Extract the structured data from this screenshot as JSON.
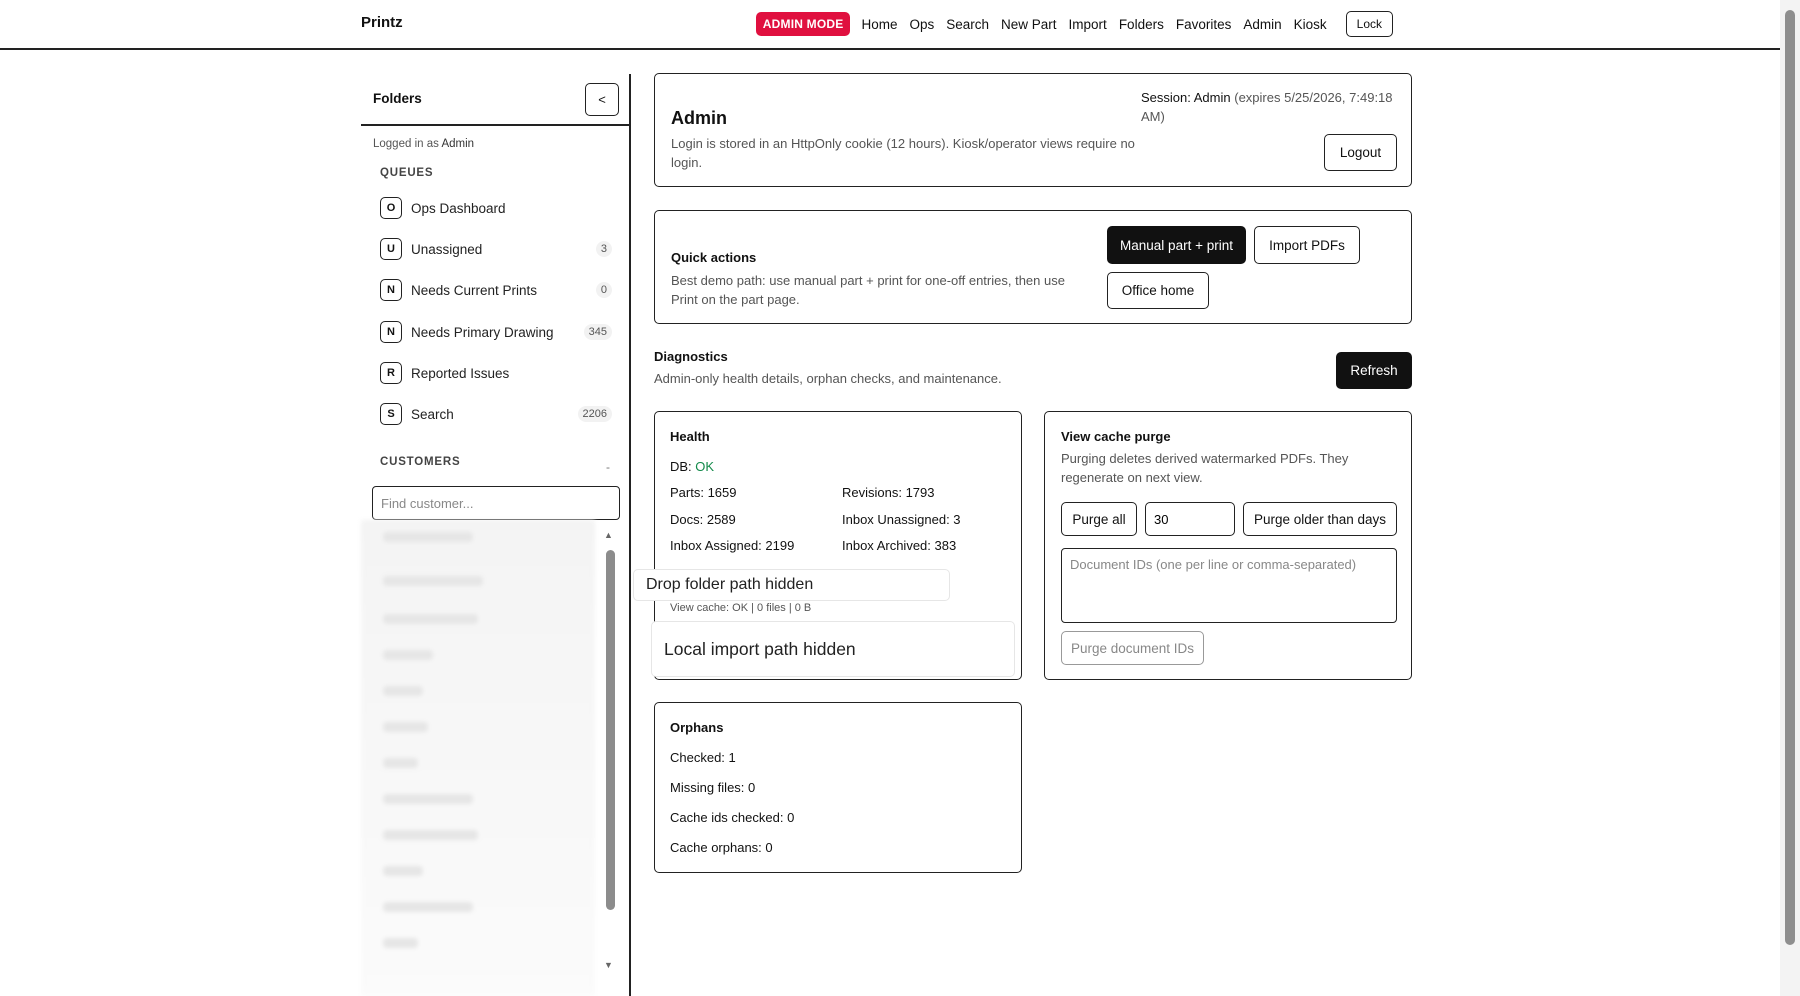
{
  "app": {
    "brand": "Printz"
  },
  "nav": {
    "admin_mode": "ADMIN MODE",
    "links": [
      "Home",
      "Ops",
      "Search",
      "New Part",
      "Import",
      "Folders",
      "Favorites",
      "Admin",
      "Kiosk"
    ],
    "lock": "Lock"
  },
  "sidebar": {
    "title": "Folders",
    "collapse": "<",
    "logged_in_prefix": "Logged in as",
    "logged_in_user": "Admin",
    "queues_label": "QUEUES",
    "queues": [
      {
        "letter": "O",
        "label": "Ops Dashboard",
        "count": ""
      },
      {
        "letter": "U",
        "label": "Unassigned",
        "count": "3"
      },
      {
        "letter": "N",
        "label": "Needs Current Prints",
        "count": "0"
      },
      {
        "letter": "N",
        "label": "Needs Primary Drawing",
        "count": "345"
      },
      {
        "letter": "R",
        "label": "Reported Issues",
        "count": ""
      },
      {
        "letter": "S",
        "label": "Search",
        "count": "2206"
      }
    ],
    "customers_label": "CUSTOMERS",
    "customers_toggle": "-",
    "find_customer_placeholder": "Find customer..."
  },
  "admin_card": {
    "title": "Admin",
    "description": "Login is stored in an HttpOnly cookie (12 hours). Kiosk/operator views require no login.",
    "session_label": "Session: Admin",
    "session_expiry": "(expires 5/25/2026, 7:49:18 AM)",
    "logout": "Logout"
  },
  "quick_actions": {
    "title": "Quick actions",
    "description": "Best demo path: use manual part + print for one-off entries, then use Print on the part page.",
    "manual_part": "Manual part + print",
    "import_pdfs": "Import PDFs",
    "office_home": "Office home"
  },
  "diagnostics": {
    "title": "Diagnostics",
    "description": "Admin-only health details, orphan checks, and maintenance.",
    "refresh": "Refresh"
  },
  "health": {
    "title": "Health",
    "db_label": "DB:",
    "db_status": "OK",
    "parts": "Parts: 1659",
    "revisions": "Revisions: 1793",
    "docs": "Docs: 2589",
    "inbox_unassigned": "Inbox Unassigned: 3",
    "inbox_assigned": "Inbox Assigned: 2199",
    "inbox_archived": "Inbox Archived: 383",
    "view_cache": "View cache: OK | 0 files | 0 B",
    "drop_folder_hidden": "Drop folder path hidden",
    "local_import_hidden": "Local import path hidden"
  },
  "cache_purge": {
    "title": "View cache purge",
    "description": "Purging deletes derived watermarked PDFs. They regenerate on next view.",
    "purge_all": "Purge all",
    "days_value": "30",
    "purge_older": "Purge older than days",
    "doc_ids_placeholder": "Document IDs (one per line or comma-separated)",
    "purge_doc_ids": "Purge document IDs"
  },
  "orphans": {
    "title": "Orphans",
    "checked": "Checked: 1",
    "missing_files": "Missing files: 0",
    "cache_ids_checked": "Cache ids checked: 0",
    "cache_orphans": "Cache orphans: 0"
  },
  "colors": {
    "admin_badge": "#e0103f",
    "ok": "#138a4a",
    "dark_button": "#111111"
  }
}
